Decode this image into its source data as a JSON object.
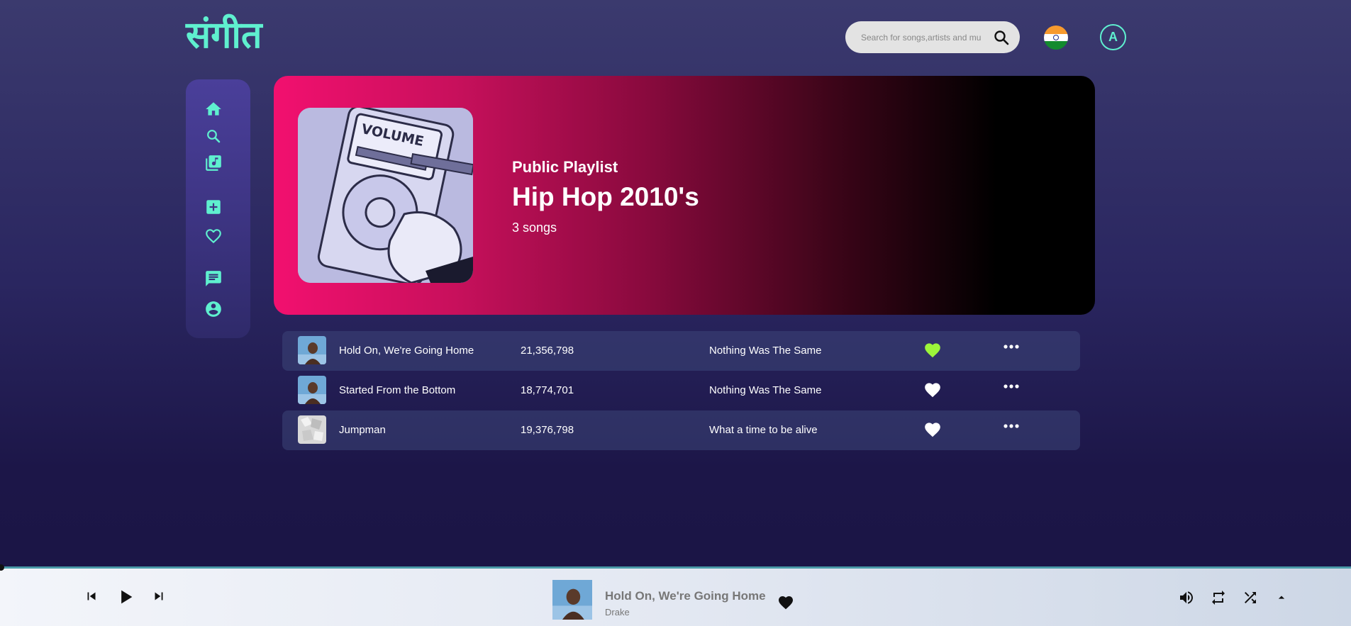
{
  "app": {
    "logo": "संगीत"
  },
  "header": {
    "search_placeholder": "Search for songs,artists and mu",
    "avatar_letter": "A"
  },
  "sidebar": {
    "items": [
      {
        "icon": "home-icon"
      },
      {
        "icon": "search-icon"
      },
      {
        "icon": "library-icon"
      },
      {
        "icon": "add-playlist-icon"
      },
      {
        "icon": "heart-icon"
      },
      {
        "icon": "chat-icon"
      },
      {
        "icon": "profile-icon"
      }
    ]
  },
  "playlist": {
    "subtitle": "Public Playlist",
    "title": "Hip Hop 2010's",
    "count": "3 songs",
    "cover_text": "VOLUME"
  },
  "tracks": [
    {
      "name": "Hold On, We're Going Home",
      "plays": "21,356,798",
      "album": "Nothing Was The Same",
      "liked": true
    },
    {
      "name": "Started From the Bottom",
      "plays": "18,774,701",
      "album": "Nothing Was The Same",
      "liked": false
    },
    {
      "name": "Jumpman",
      "plays": "19,376,798",
      "album": "What a time to be alive",
      "liked": false
    }
  ],
  "player": {
    "title": "Hold On, We're Going Home",
    "artist": "Drake",
    "progress": 0
  },
  "colors": {
    "accent": "#5ff0cf",
    "liked_heart": "#9cf53a",
    "hero_start": "#f2106f",
    "hero_end": "#000000"
  }
}
